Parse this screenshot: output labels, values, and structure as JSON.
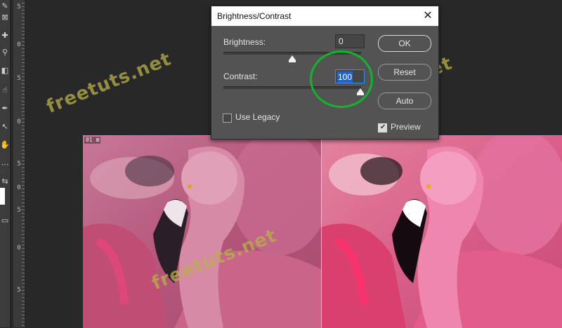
{
  "ruler": {
    "marks": [
      "5",
      "0",
      "5",
      "0",
      "5",
      "0",
      "5",
      "0",
      "5"
    ]
  },
  "canvas": {
    "doc_label": "01 ⊠"
  },
  "watermark": {
    "text": "freetuts.net"
  },
  "dialog": {
    "title": "Brightness/Contrast",
    "close_glyph": "✕",
    "brightness": {
      "label": "Brightness:",
      "value": "0",
      "slider_position": 0.5
    },
    "contrast": {
      "label": "Contrast:",
      "value": "100",
      "slider_position": 1.0
    },
    "buttons": {
      "ok": "OK",
      "reset": "Reset",
      "auto": "Auto"
    },
    "use_legacy": {
      "label": "Use Legacy",
      "checked": false
    },
    "preview": {
      "label": "Preview",
      "checked": true
    }
  },
  "colors": {
    "highlight_circle": "#11b52c",
    "field_selection": "#2563c7"
  }
}
